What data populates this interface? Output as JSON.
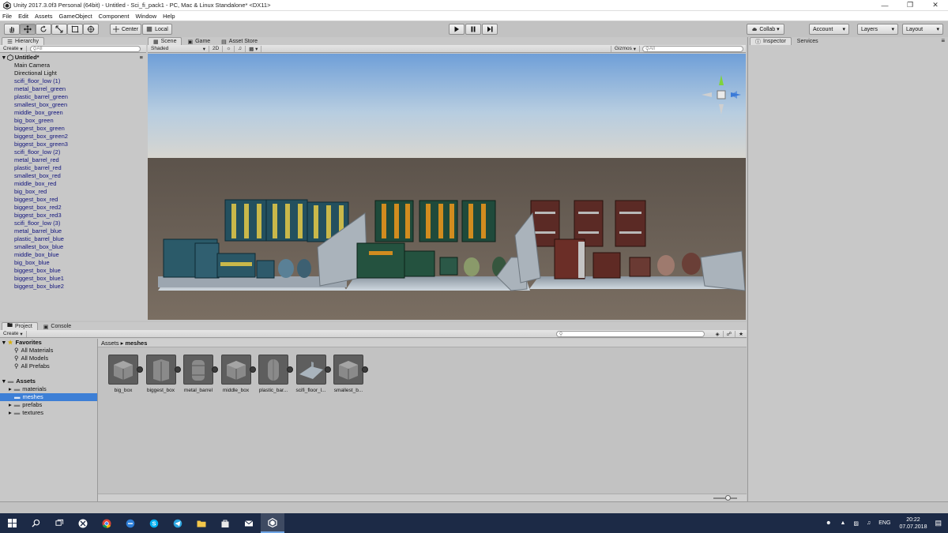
{
  "window": {
    "title": "Unity 2017.3.0f3 Personal (64bit) - Untitled - Sci_fi_pack1 - PC, Mac & Linux Standalone* <DX11>"
  },
  "menu": [
    "File",
    "Edit",
    "Assets",
    "GameObject",
    "Component",
    "Window",
    "Help"
  ],
  "toolbar": {
    "pivot_label": "Center",
    "space_label": "Local",
    "collab_label": "Collab",
    "account_label": "Account",
    "layers_label": "Layers",
    "layout_label": "Layout"
  },
  "hierarchy": {
    "tab": "Hierarchy",
    "create": "Create",
    "search_placeholder": "All",
    "scene_name": "Untitled*",
    "items": [
      "Main Camera",
      "Directional Light",
      "scifi_floor_low (1)",
      "metal_barrel_green",
      "plastic_barrel_green",
      "smallest_box_green",
      "middle_box_green",
      "big_box_green",
      "biggest_box_green",
      "biggest_box_green2",
      "biggest_box_green3",
      "scifi_floor_low (2)",
      "metal_barrel_red",
      "plastic_barrel_red",
      "smallest_box_red",
      "middle_box_red",
      "big_box_red",
      "biggest_box_red",
      "biggest_box_red2",
      "biggest_box_red3",
      "scifi_floor_low (3)",
      "metal_barrel_blue",
      "plastic_barrel_blue",
      "smallest_box_blue",
      "middle_box_blue",
      "big_box_blue",
      "biggest_box_blue",
      "biggest_box_blue1",
      "biggest_box_blue2"
    ]
  },
  "scene": {
    "tabs": [
      "Scene",
      "Game",
      "Asset Store"
    ],
    "shading": "Shaded",
    "mode_2d": "2D",
    "gizmos": "Gizmos",
    "search_placeholder": "All"
  },
  "inspector": {
    "tabs": [
      "Inspector",
      "Services"
    ]
  },
  "project": {
    "tabs": [
      "Project",
      "Console"
    ],
    "create": "Create",
    "favorites": "Favorites",
    "favorite_items": [
      "All Materials",
      "All Models",
      "All Prefabs"
    ],
    "assets_root": "Assets",
    "folders": [
      "materials",
      "meshes",
      "prefabs",
      "textures"
    ],
    "breadcrumb": [
      "Assets",
      "meshes"
    ],
    "assets": [
      "big_box",
      "biggest_box",
      "metal_barrel",
      "middle_box",
      "plastic_bar...",
      "scifi_floor_l...",
      "smallest_b..."
    ]
  },
  "taskbar": {
    "lang": "ENG",
    "time": "20:22",
    "date": "07.07.2018"
  },
  "colors": {
    "selection": "#3d7fd6",
    "hierarchy_link": "#12157d",
    "taskbar": "#1c2a46",
    "sky_top": "#6f9fd8",
    "ground": "#6e6358"
  }
}
